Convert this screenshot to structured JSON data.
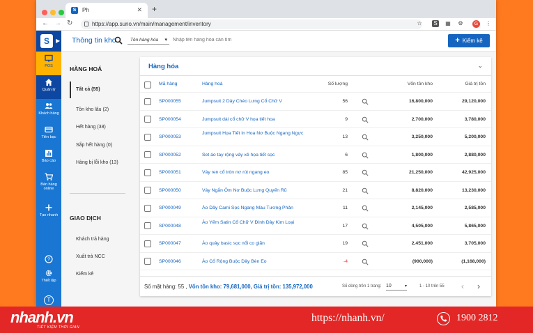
{
  "browser": {
    "tab_title": "Ph",
    "url": "https://app.suno.vn/main/management/inventory",
    "profile_initial": "G"
  },
  "sidebar": {
    "logo_letter": "S",
    "items": [
      {
        "label": "POS",
        "icon": "monitor-icon"
      },
      {
        "label": "Quản lý",
        "icon": "home-icon"
      },
      {
        "label": "Khách hàng",
        "icon": "users-icon"
      },
      {
        "label": "Tiền bạc",
        "icon": "credit-card-icon"
      },
      {
        "label": "Báo cáo",
        "icon": "bar-chart-icon"
      },
      {
        "label": "Bán hàng online",
        "icon": "cart-icon"
      },
      {
        "label": "Tạo nhanh",
        "icon": "plus-icon"
      },
      {
        "label": "Trợ giúp",
        "icon": "help-icon"
      },
      {
        "label": "Thiết lập",
        "icon": "gear-icon"
      },
      {
        "label": "T",
        "icon": "user-avatar"
      }
    ]
  },
  "topbar": {
    "title": "Thông tin kho",
    "search_type": "Tên hàng hóa",
    "search_placeholder": "Nhập tên hàng hóa cần tìm",
    "action_button": "Kiểm kê"
  },
  "leftnav": {
    "section1": "HÀNG HOÁ",
    "items1": [
      "Tất cả (55)",
      "Tồn kho lâu (2)",
      "Hết hàng (38)",
      "Sắp hết hàng (0)",
      "Hàng bị lỗi kho (13)"
    ],
    "section2": "GIAO DỊCH",
    "items2": [
      "Khách trả hàng",
      "Xuất trả NCC",
      "Kiểm kê"
    ]
  },
  "card": {
    "title": "Hàng hóa",
    "headers": {
      "code": "Mã hàng",
      "name": "Hàng hoá",
      "qty": "Số lượng",
      "stock": "Vốn tồn kho",
      "value": "Giá trị tồn"
    },
    "rows": [
      {
        "code": "SP000055",
        "name": "Jumpsuit 2 Dây Chéo Lưng Cổ Chữ V",
        "qty": "56",
        "stock": "16,800,000",
        "value": "29,120,000"
      },
      {
        "code": "SP000054",
        "name": "Jumpsuit dài cổ chữ V họa tiết hoa",
        "qty": "9",
        "stock": "2,700,000",
        "value": "3,780,000"
      },
      {
        "code": "SP000053",
        "name": "Jumpsuit Họa Tiết In Hoa Nơ Buộc Ngang Ngực",
        "qty": "13",
        "stock": "3,250,000",
        "value": "5,200,000"
      },
      {
        "code": "SP000052",
        "name": "Set áo tay rộng váy xẻ họa tiết sọc",
        "qty": "6",
        "stock": "1,800,000",
        "value": "2,880,000"
      },
      {
        "code": "SP000051",
        "name": "Váy ren cổ tròn nơ rút ngang eo",
        "qty": "85",
        "stock": "21,250,000",
        "value": "42,925,000"
      },
      {
        "code": "SP000050",
        "name": "Váy Ngắn Ôm Nơ Buộc Lưng Quyến Rũ",
        "qty": "21",
        "stock": "8,820,000",
        "value": "13,230,000"
      },
      {
        "code": "SP000049",
        "name": "Áo Dây Cami Sọc Ngang Màu Tương Phản",
        "qty": "11",
        "stock": "2,145,000",
        "value": "2,585,000"
      },
      {
        "code": "SP000048",
        "name": "Áo Yếm Satin Cổ Chữ V Đính Dây Kim Loại",
        "qty": "17",
        "stock": "4,505,000",
        "value": "5,865,000"
      },
      {
        "code": "SP000047",
        "name": "Áo quây basic sọc nổi co giãn",
        "qty": "19",
        "stock": "2,451,000",
        "value": "3,705,000"
      },
      {
        "code": "SP000046",
        "name": "Áo Cổ Rộng Buộc Dây Bèn Eo",
        "qty": "-4",
        "stock": "(900,000)",
        "value": "(1,168,000)"
      }
    ],
    "footer": {
      "count_label": "Số mặt hàng: 55 ,",
      "stock_label": "Vốn tồn kho: 79,681,000,",
      "value_label": "Giá trị tồn: 135,972,000",
      "per_page_label": "Số dòng trên 1 trang:",
      "per_page": "10",
      "range": "1 - 10 trên 55"
    }
  },
  "banner": {
    "brand": "nhanh.vn",
    "tagline": "TIẾT KIỆM THỜI GIAN",
    "website": "https://nhanh.vn/",
    "hotline": "1900 2812"
  },
  "colors": {
    "primary": "#1565c0",
    "sidebar": "#1976d2",
    "sidebar_active": "#0d47a1",
    "pos": "#ffb300",
    "banner": "#e22726",
    "background": "#ff7a1f"
  }
}
